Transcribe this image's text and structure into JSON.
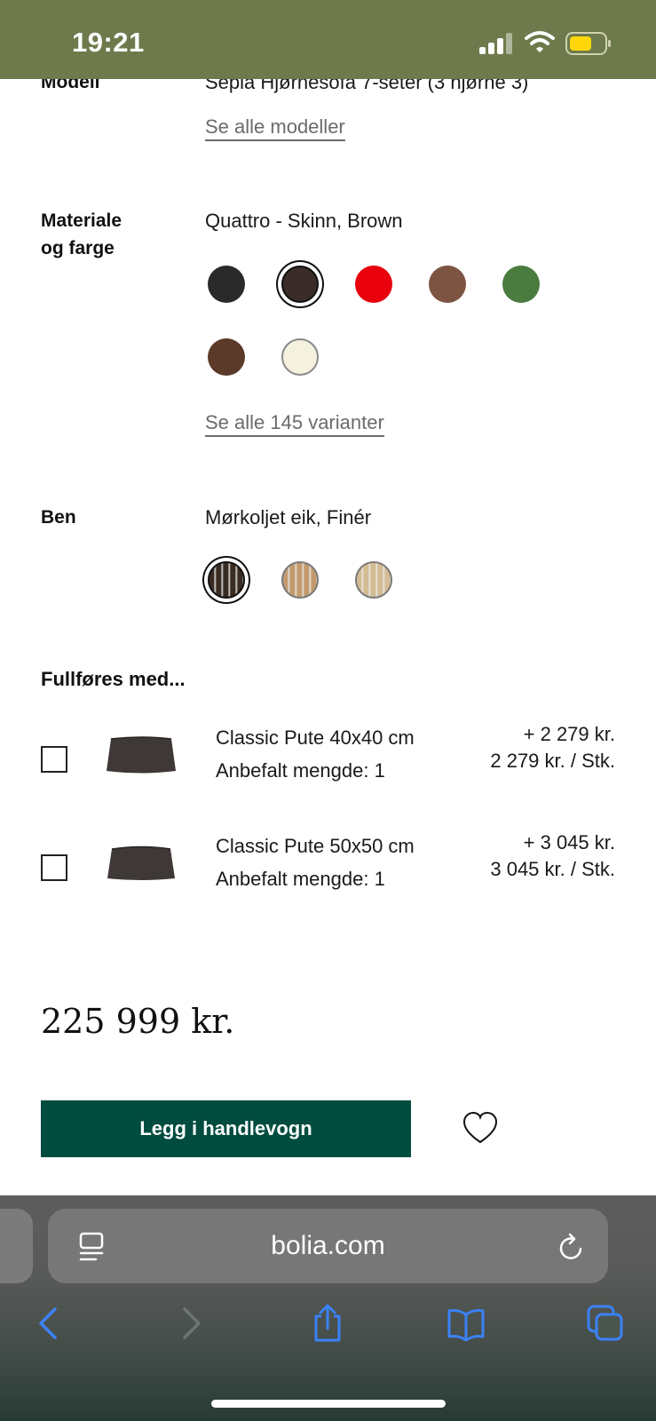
{
  "status_bar": {
    "time": "19:21"
  },
  "model": {
    "label": "Modell",
    "value": "Sepia Hjørnesofa 7-seter (3 hjørne 3)",
    "link": "Se alle modeller"
  },
  "material": {
    "label_line1": "Materiale",
    "label_line2": "og farge",
    "value": "Quattro - Skinn, Brown",
    "swatches": [
      "#2a2a2a",
      "#3b2c29",
      "#e8000d",
      "#7d5442",
      "#4a7c3f",
      "#5c3a2a",
      "#f4f1de"
    ],
    "selected_index": 1,
    "link": "Se alle 145 varianter"
  },
  "legs": {
    "label": "Ben",
    "value": "Mørkoljet eik, Finér",
    "swatches": [
      "#3a2c22",
      "#c39a6d",
      "#d3bb94"
    ],
    "selected_index": 0
  },
  "addons": {
    "title": "Fullføres med...",
    "items": [
      {
        "name": "Classic Pute 40x40 cm",
        "qty": "Anbefalt mengde: 1",
        "price": "+ 2 279 kr.",
        "unit_price": "2 279 kr. / Stk."
      },
      {
        "name": "Classic Pute 50x50 cm",
        "qty": "Anbefalt mengde: 1",
        "price": "+ 3 045 kr.",
        "unit_price": "3 045 kr. / Stk."
      }
    ]
  },
  "total_price": "225 999 kr.",
  "cart_button": "Legg i handlevogn",
  "browser": {
    "url": "bolia.com"
  },
  "colors": {
    "brand_green": "#004c3f",
    "status_bar": "#6e7a4b",
    "ios_blue": "#3b82f6"
  }
}
